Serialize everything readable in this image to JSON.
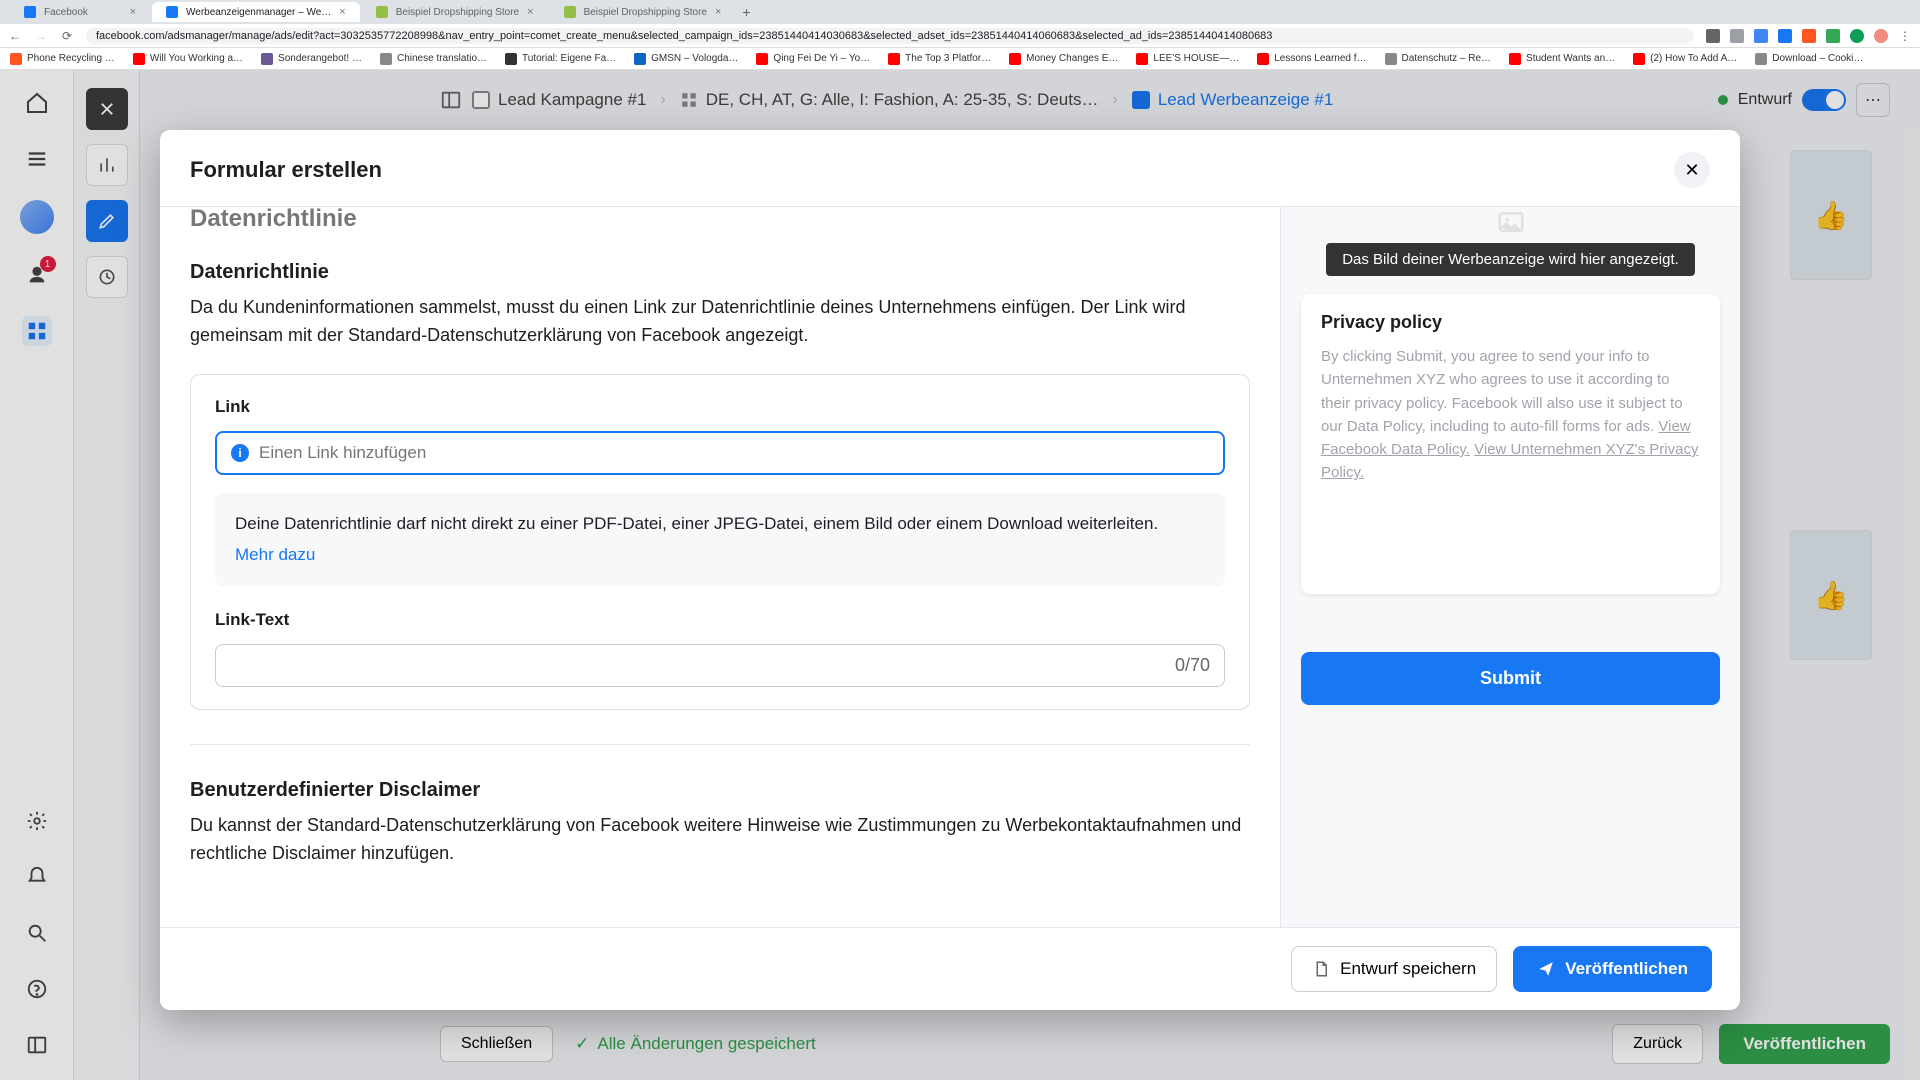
{
  "browser": {
    "tabs": [
      {
        "title": "Facebook",
        "color": "#1877f2"
      },
      {
        "title": "Werbeanzeigenmanager – We…",
        "color": "#1877f2",
        "active": true
      },
      {
        "title": "Beispiel Dropshipping Store",
        "color": "#95bf47"
      },
      {
        "title": "Beispiel Dropshipping Store",
        "color": "#95bf47"
      }
    ],
    "url": "facebook.com/adsmanager/manage/ads/edit?act=3032535772208998&nav_entry_point=comet_create_menu&selected_campaign_ids=23851440414030683&selected_adset_ids=23851440414060683&selected_ad_ids=23851440414080683",
    "bookmarks": [
      "Phone Recycling …",
      "Will You Working a…",
      "Sonderangebot! …",
      "Chinese translatio…",
      "Tutorial: Eigene Fa…",
      "GMSN – Vologda…",
      "Qing Fei De Yi – Yo…",
      "The Top 3 Platfor…",
      "Money Changes E…",
      "LEE'S HOUSE—…",
      "Lessons Learned f…",
      "Datenschutz – Re…",
      "Student Wants an…",
      "(2) How To Add A…",
      "Download – Cooki…"
    ]
  },
  "ads_manager": {
    "breadcrumb": {
      "campaign": "Lead Kampagne #1",
      "adset": "DE, CH, AT, G: Alle, I: Fashion, A: 25-35, S: Deuts…",
      "ad": "Lead Werbeanzeige #1"
    },
    "status": "Entwurf",
    "notification_count": "1",
    "footer": {
      "close": "Schließen",
      "saved": "Alle Änderungen gespeichert",
      "back": "Zurück",
      "publish": "Veröffentlichen"
    }
  },
  "modal": {
    "title": "Formular erstellen",
    "scroll_header": "Datenrichtlinie",
    "section": {
      "heading": "Datenrichtlinie",
      "description": "Da du Kundeninformationen sammelst, musst du einen Link zur Datenrichtlinie deines Unternehmens einfügen. Der Link wird gemeinsam mit der Standard-Datenschutzerklärung von Facebook angezeigt."
    },
    "link_field": {
      "label": "Link",
      "placeholder": "Einen Link hinzufügen",
      "note": "Deine Datenrichtlinie darf nicht direkt zu einer PDF-Datei, einer JPEG-Datei, einem Bild oder einem Download weiterleiten.",
      "learn_more": "Mehr dazu"
    },
    "linktext_field": {
      "label": "Link-Text",
      "counter": "0/70"
    },
    "disclaimer": {
      "heading": "Benutzerdefinierter Disclaimer",
      "description": "Du kannst der Standard-Datenschutzerklärung von Facebook weitere Hinweise wie Zustimmungen zu Werbekontaktaufnahmen und rechtliche Disclaimer hinzufügen."
    },
    "preview": {
      "banner": "Das Bild deiner Werbeanzeige wird hier angezeigt.",
      "card_title": "Privacy policy",
      "body_text": "By clicking Submit, you agree to send your info to Unternehmen XYZ who agrees to use it according to their privacy policy. Facebook will also use it subject to our Data Policy, including to auto-fill forms for ads. ",
      "link1": "View Facebook Data Policy.",
      "link2": "View Unternehmen XYZ's Privacy Policy.",
      "submit": "Submit"
    },
    "footer": {
      "save_draft": "Entwurf speichern",
      "publish": "Veröffentlichen"
    }
  }
}
